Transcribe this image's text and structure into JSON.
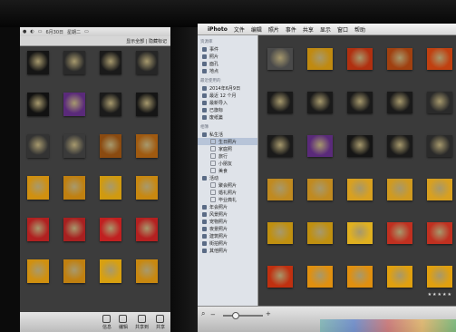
{
  "left_window": {
    "toolbar_text": "显示全部 | 隐藏标记",
    "menu_text": [
      "●",
      "◐",
      "▭",
      "6月30日",
      "星期二",
      "▭"
    ],
    "bottom_tools": [
      {
        "icon": "info-icon",
        "label": "信息"
      },
      {
        "icon": "edit-icon",
        "label": "编辑"
      },
      {
        "icon": "create-icon",
        "label": "共享到"
      },
      {
        "icon": "share-icon",
        "label": "共享"
      }
    ]
  },
  "menubar": {
    "apple": "",
    "app_name": "iPhoto",
    "items": [
      "文件",
      "编辑",
      "照片",
      "事件",
      "共享",
      "显示",
      "窗口",
      "帮助"
    ]
  },
  "sidebar": {
    "sections": [
      {
        "header": "资源库",
        "items": [
          {
            "label": "事件",
            "icon": "events-icon"
          },
          {
            "label": "照片",
            "icon": "photos-icon"
          },
          {
            "label": "面孔",
            "icon": "faces-icon"
          },
          {
            "label": "地点",
            "icon": "places-icon"
          }
        ]
      },
      {
        "header": "最近使用的",
        "items": [
          {
            "label": "2014年6月9日",
            "icon": "event-icon"
          },
          {
            "label": "最近 12 个月",
            "icon": "calendar-icon"
          },
          {
            "label": "最新导入",
            "icon": "import-icon"
          },
          {
            "label": "已旗标",
            "icon": "flag-icon"
          },
          {
            "label": "废纸篓",
            "icon": "trash-icon"
          }
        ]
      },
      {
        "header": "相簿",
        "items": [
          {
            "label": "私生活",
            "icon": "folder-icon",
            "selected": false
          },
          {
            "label": "生日照片",
            "icon": "album-icon",
            "sub": true,
            "selected": true
          },
          {
            "label": "家庭照",
            "icon": "album-icon",
            "sub": true
          },
          {
            "label": "旅行",
            "icon": "album-icon",
            "sub": true
          },
          {
            "label": "小朋友",
            "icon": "album-icon",
            "sub": true
          },
          {
            "label": "美食",
            "icon": "album-icon",
            "sub": true
          },
          {
            "label": "活动",
            "icon": "folder-icon"
          },
          {
            "label": "聚会照片",
            "icon": "album-icon",
            "sub": true
          },
          {
            "label": "婚礼照片",
            "icon": "album-icon",
            "sub": true
          },
          {
            "label": "毕业典礼",
            "icon": "album-icon",
            "sub": true
          },
          {
            "label": "年会照片",
            "icon": "album-icon"
          },
          {
            "label": "风景照片",
            "icon": "album-icon"
          },
          {
            "label": "宠物照片",
            "icon": "album-icon"
          },
          {
            "label": "夜景照片",
            "icon": "album-icon"
          },
          {
            "label": "建筑照片",
            "icon": "album-icon"
          },
          {
            "label": "街拍照片",
            "icon": "album-icon"
          },
          {
            "label": "其他照片",
            "icon": "album-icon"
          }
        ]
      }
    ]
  },
  "bottom_bar": {
    "search_icon": "search-icon",
    "zoom_min": "−",
    "zoom_max": "+",
    "zoom_level": 0.3
  },
  "rating_text": "★★★★★",
  "colors": {
    "sidebar_bg": "#dfe3e9",
    "selection": "#b7c4d8",
    "photo_bg": "#3a3a3a",
    "warm_gold": "#e0a020",
    "red": "#c02020"
  },
  "left_photos": [
    {
      "row": 0,
      "col": 0,
      "c": "#151515"
    },
    {
      "row": 0,
      "col": 1,
      "c": "#2a2a2a"
    },
    {
      "row": 0,
      "col": 2,
      "c": "#1a1a1a"
    },
    {
      "row": 0,
      "col": 3,
      "c": "#262626"
    },
    {
      "row": 1,
      "col": 0,
      "c": "#111"
    },
    {
      "row": 1,
      "col": 1,
      "c": "#5a2a7a"
    },
    {
      "row": 1,
      "col": 2,
      "c": "#1a1a1a"
    },
    {
      "row": 1,
      "col": 3,
      "c": "#151515"
    },
    {
      "row": 2,
      "col": 0,
      "c": "#333"
    },
    {
      "row": 2,
      "col": 1,
      "c": "#3a3a3a"
    },
    {
      "row": 2,
      "col": 2,
      "c": "#8a4a10"
    },
    {
      "row": 2,
      "col": 3,
      "c": "#a05a10"
    },
    {
      "row": 3,
      "col": 0,
      "c": "#d09010"
    },
    {
      "row": 3,
      "col": 1,
      "c": "#c08010"
    },
    {
      "row": 3,
      "col": 2,
      "c": "#d09a10"
    },
    {
      "row": 3,
      "col": 3,
      "c": "#c88810"
    },
    {
      "row": 4,
      "col": 0,
      "c": "#b02020"
    },
    {
      "row": 4,
      "col": 1,
      "c": "#a82020"
    },
    {
      "row": 4,
      "col": 2,
      "c": "#c02020"
    },
    {
      "row": 4,
      "col": 3,
      "c": "#b42020"
    },
    {
      "row": 5,
      "col": 0,
      "c": "#d09010"
    },
    {
      "row": 5,
      "col": 1,
      "c": "#c08010"
    },
    {
      "row": 5,
      "col": 2,
      "c": "#d8a010"
    },
    {
      "row": 5,
      "col": 3,
      "c": "#c88810"
    }
  ],
  "right_photos": [
    {
      "row": 0,
      "col": 0,
      "c": "#4a4a4a"
    },
    {
      "row": 0,
      "col": 1,
      "c": "#c08a10"
    },
    {
      "row": 0,
      "col": 2,
      "c": "#b03010"
    },
    {
      "row": 0,
      "col": 3,
      "c": "#a04010"
    },
    {
      "row": 0,
      "col": 4,
      "c": "#c04010"
    },
    {
      "row": 1,
      "col": 0,
      "c": "#1a1a1a"
    },
    {
      "row": 1,
      "col": 1,
      "c": "#1a1a1a"
    },
    {
      "row": 1,
      "col": 2,
      "c": "#1a1a1a"
    },
    {
      "row": 1,
      "col": 3,
      "c": "#1a1a1a"
    },
    {
      "row": 1,
      "col": 4,
      "c": "#2a2a2a"
    },
    {
      "row": 2,
      "col": 0,
      "c": "#1a1a1a"
    },
    {
      "row": 2,
      "col": 1,
      "c": "#5a2a7a"
    },
    {
      "row": 2,
      "col": 2,
      "c": "#151515"
    },
    {
      "row": 2,
      "col": 3,
      "c": "#1a1a1a"
    },
    {
      "row": 2,
      "col": 4,
      "c": "#2a2a2a"
    },
    {
      "row": 3,
      "col": 0,
      "c": "#c08a20"
    },
    {
      "row": 3,
      "col": 1,
      "c": "#c08a20"
    },
    {
      "row": 3,
      "col": 2,
      "c": "#d8a020"
    },
    {
      "row": 3,
      "col": 3,
      "c": "#d09a20"
    },
    {
      "row": 3,
      "col": 4,
      "c": "#d8a020"
    },
    {
      "row": 4,
      "col": 0,
      "c": "#c09010"
    },
    {
      "row": 4,
      "col": 1,
      "c": "#c09010"
    },
    {
      "row": 4,
      "col": 2,
      "c": "#e0b020"
    },
    {
      "row": 4,
      "col": 3,
      "c": "#c03020"
    },
    {
      "row": 4,
      "col": 4,
      "c": "#c03020"
    },
    {
      "row": 5,
      "col": 0,
      "c": "#c03010"
    },
    {
      "row": 5,
      "col": 1,
      "c": "#e09010"
    },
    {
      "row": 5,
      "col": 2,
      "c": "#e09010"
    },
    {
      "row": 5,
      "col": 3,
      "c": "#e0a010"
    },
    {
      "row": 5,
      "col": 4,
      "c": "#e0a010"
    }
  ]
}
